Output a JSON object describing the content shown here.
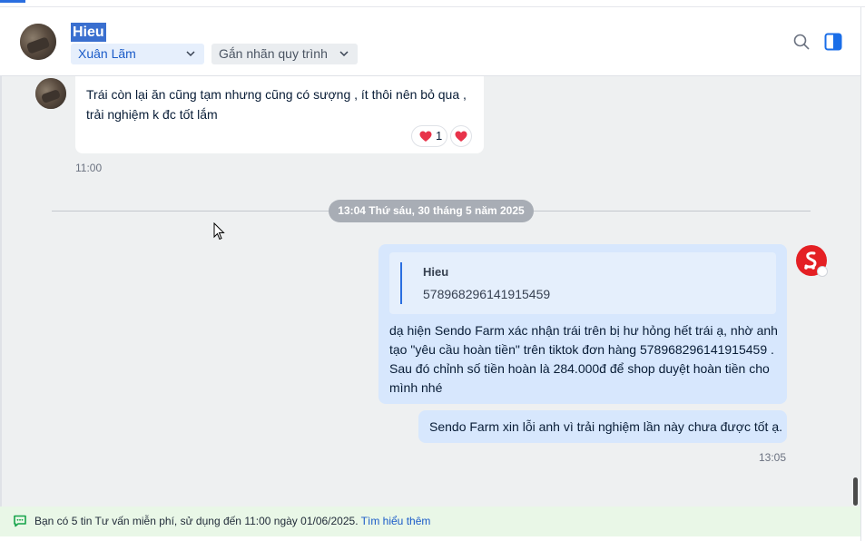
{
  "header": {
    "contact_name": "Hieu",
    "owner_dropdown": "Xuân Lãm",
    "label_dropdown": "Gắn nhãn quy trình"
  },
  "messages": {
    "incoming": {
      "text": "Trái còn lại ăn cũng tạm nhưng cũng có sượng , ít thôi nên bỏ qua ,\ntrải nghiệm k đc tốt lắm",
      "reaction_count": "1",
      "time": "11:00"
    },
    "date_separator": "13:04 Thứ sáu, 30 tháng 5 năm 2025",
    "outgoing_reply": {
      "quote_name": "Hieu",
      "quote_text": "578968296141915459",
      "text": "dạ hiện Sendo Farm xác nhận trái trên bị hư hỏng hết trái ạ, nhờ anh tạo \"yêu cầu hoàn tiền\" trên tiktok đơn hàng 578968296141915459 . Sau đó chỉnh số tiền hoàn là 284.000đ để shop duyệt hoàn tiền cho mình nhé"
    },
    "outgoing_second": {
      "text": "Sendo Farm xin lỗi anh vì trải nghiệm lần này chưa được tốt ạ.",
      "time": "13:05"
    }
  },
  "banner": {
    "text": "Bạn có 5 tin Tư vấn miễn phí, sử dụng đến 11:00 ngày 01/06/2025.",
    "link": "Tìm hiểu thêm"
  },
  "colors": {
    "accent": "#2a6ee0",
    "outgoing_bubble": "#d7e7fd",
    "chat_background": "#eef0f1",
    "banner_background": "#e9f7e7",
    "reaction_heart": "#e8334a",
    "sendo_brand": "#e42024"
  },
  "icons": {
    "search": "search-icon",
    "panel": "side-panel-icon",
    "chevron": "chevron-down-icon",
    "heart": "heart-icon",
    "chat_bubble": "message-icon"
  }
}
